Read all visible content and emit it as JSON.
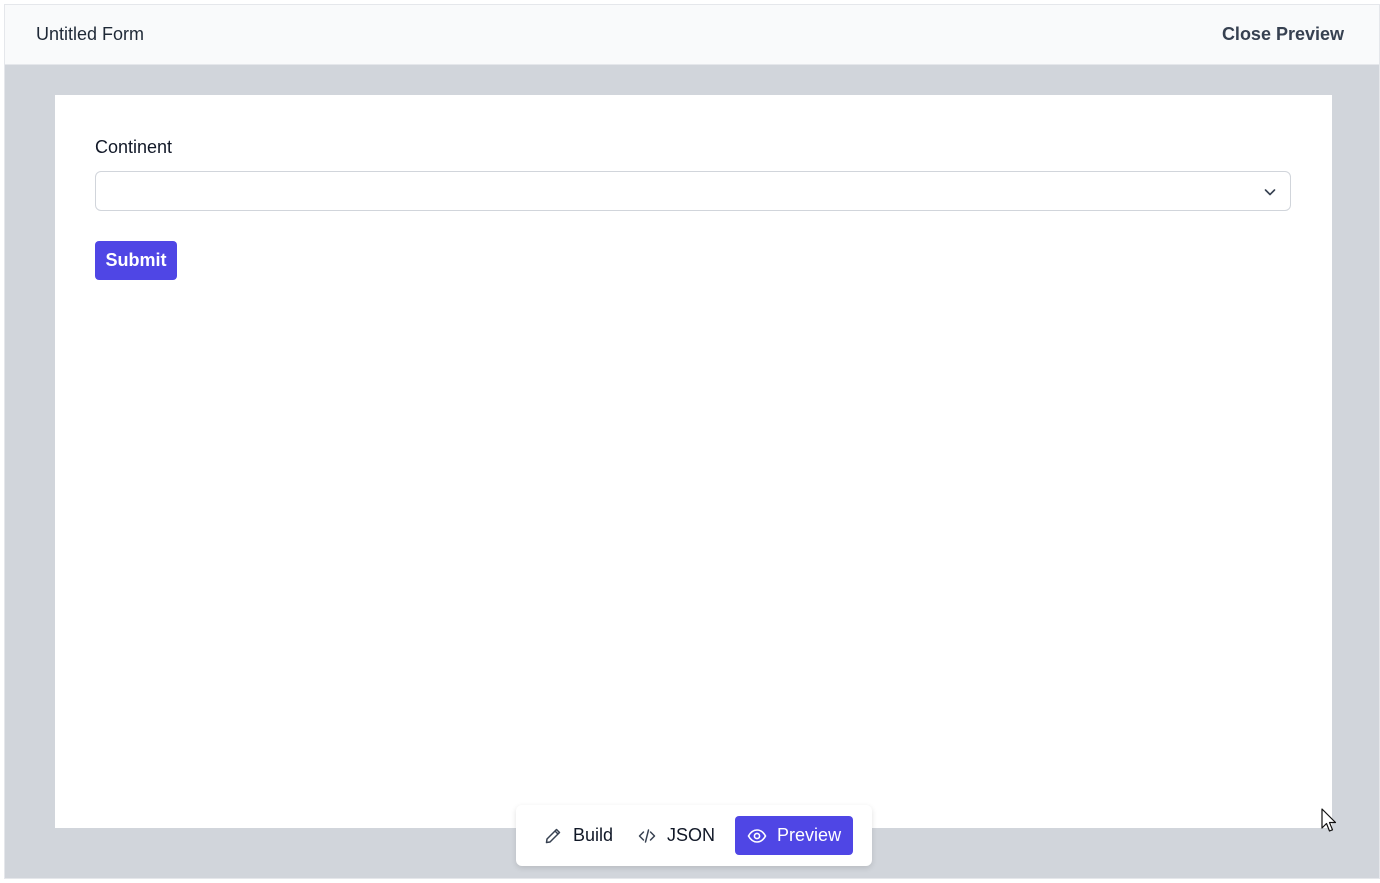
{
  "topbar": {
    "title": "Untitled Form",
    "close_label": "Close Preview"
  },
  "form": {
    "field": {
      "label": "Continent",
      "value": "",
      "icon": "chevron-down-icon"
    },
    "submit_label": "Submit"
  },
  "mode_bar": {
    "items": [
      {
        "label": "Build",
        "icon": "pencil-icon",
        "active": false
      },
      {
        "label": "JSON",
        "icon": "code-icon",
        "active": false
      },
      {
        "label": "Preview",
        "icon": "eye-icon",
        "active": true
      }
    ]
  },
  "colors": {
    "accent": "#4f46e5",
    "backdrop": "#d1d5db",
    "topbar_bg": "#f9fafb"
  }
}
